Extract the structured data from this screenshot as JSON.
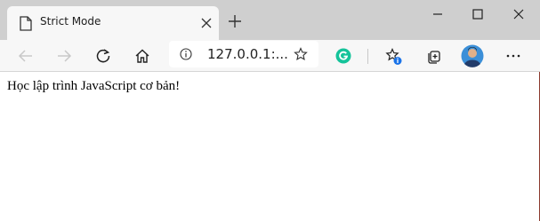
{
  "tab": {
    "title": "Strict Mode",
    "icon": "page-icon"
  },
  "toolbar": {
    "url": "127.0.0.1:...",
    "icons": [
      "back-icon",
      "forward-icon",
      "refresh-icon",
      "home-icon",
      "info-icon",
      "favorite-star-icon",
      "grammarly-icon",
      "favorites-icon",
      "collections-icon",
      "avatar",
      "more-icon"
    ]
  },
  "page": {
    "text": "Học lập trình JavaScript cơ bản!"
  },
  "colors": {
    "titlebar": "#cfcfcf",
    "toolbar": "#f7f7f7",
    "grammarly": "#15c39a",
    "badge": "#1a73e8"
  }
}
